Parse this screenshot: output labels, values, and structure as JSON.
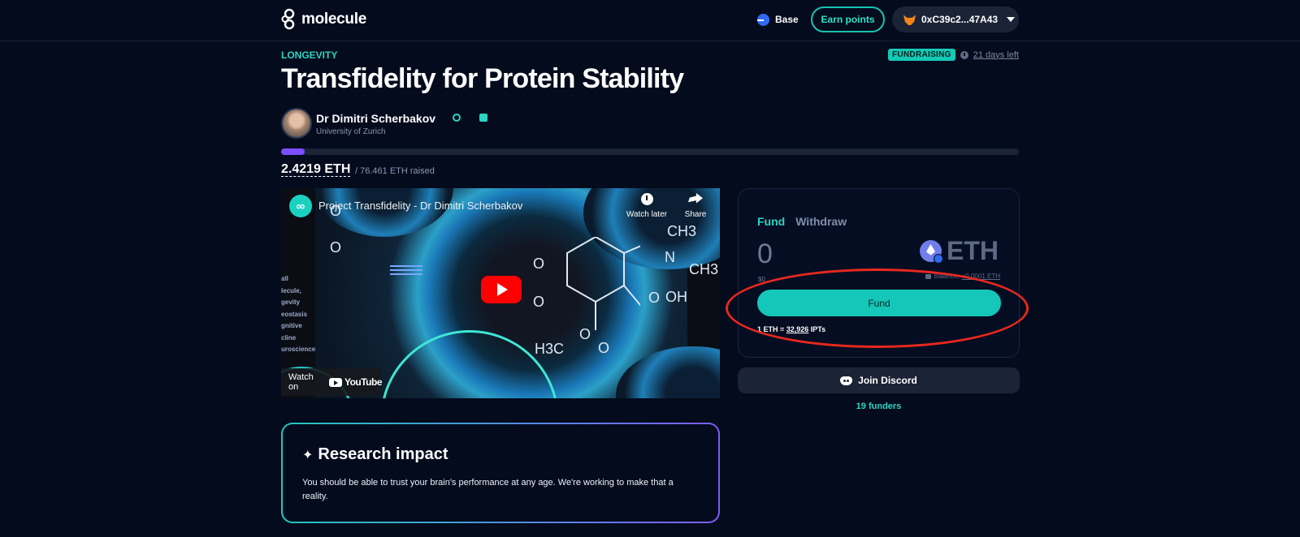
{
  "header": {
    "brand": "molecule",
    "network": "Base",
    "earn_label": "Earn points",
    "wallet_address": "0xC39c2...47A43"
  },
  "project": {
    "category": "LONGEVITY",
    "status": "FUNDRAISING",
    "time_left": "21 days left",
    "title": "Transfidelity for Protein Stability",
    "author_name": "Dr Dimitri Scherbakov",
    "author_affiliation": "University of Zurich",
    "progress_fraction": 0.032,
    "raised_amount": "2.4219 ETH",
    "raised_total": "/ 76.461 ETH raised"
  },
  "video": {
    "title": "Project Transfidelity - Dr Dimitri Scherbakov",
    "watch_later": "Watch later",
    "share": "Share",
    "watch_on": "Watch on",
    "youtube": "YouTube",
    "side_lines": [
      "all",
      "lecule,",
      "gevity",
      "eostasis",
      "gnitive",
      "cline",
      "uroscience"
    ],
    "chem_labels": [
      "CH3",
      "N",
      "CH3",
      "O",
      "O",
      "O",
      "O",
      "OH",
      "O",
      "H3C",
      "O",
      "O"
    ]
  },
  "impact": {
    "title": "Research impact",
    "text": "You should be able to trust your brain's performance at any age. We're working to make that a reality."
  },
  "fund_card": {
    "tab_fund": "Fund",
    "tab_withdraw": "Withdraw",
    "amount_value": "0",
    "amount_usd": "$0",
    "currency": "ETH",
    "balance_label": "Balance:",
    "balance_value": "<0.0001 ETH",
    "fund_button": "Fund",
    "rate_prefix": "1 ETH = ",
    "rate_value": "32,926",
    "rate_suffix": " IPTs"
  },
  "community": {
    "discord_label": "Join Discord",
    "funders": "19 funders"
  },
  "colors": {
    "accent": "#14c7b8",
    "progress": "#7c4dff",
    "annotation": "#e8281e"
  }
}
